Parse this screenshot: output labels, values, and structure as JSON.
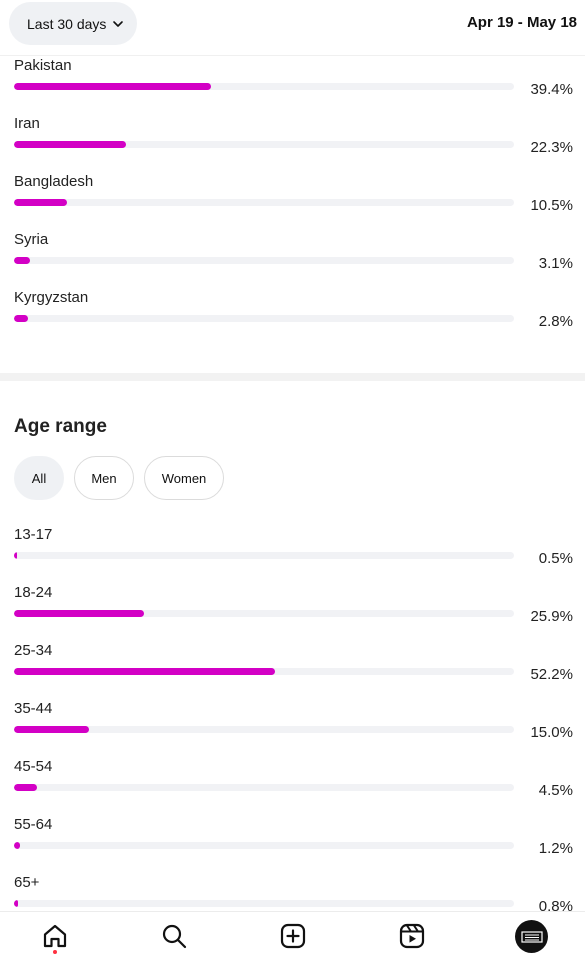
{
  "header": {
    "range_label": "Last 30 days",
    "date_range": "Apr 19 - May 18"
  },
  "countries": [
    {
      "label": "Pakistan",
      "percent": "39.4%",
      "value": 39.4
    },
    {
      "label": "Iran",
      "percent": "22.3%",
      "value": 22.3
    },
    {
      "label": "Bangladesh",
      "percent": "10.5%",
      "value": 10.5
    },
    {
      "label": "Syria",
      "percent": "3.1%",
      "value": 3.1
    },
    {
      "label": "Kyrgyzstan",
      "percent": "2.8%",
      "value": 2.8
    }
  ],
  "age": {
    "title": "Age range",
    "filters": [
      "All",
      "Men",
      "Women"
    ],
    "selected_filter": "All",
    "ranges": [
      {
        "label": "13-17",
        "percent": "0.5%",
        "value": 0.5
      },
      {
        "label": "18-24",
        "percent": "25.9%",
        "value": 25.9
      },
      {
        "label": "25-34",
        "percent": "52.2%",
        "value": 52.2
      },
      {
        "label": "35-44",
        "percent": "15.0%",
        "value": 15.0
      },
      {
        "label": "45-54",
        "percent": "4.5%",
        "value": 4.5
      },
      {
        "label": "55-64",
        "percent": "1.2%",
        "value": 1.2
      },
      {
        "label": "65+",
        "percent": "0.8%",
        "value": 0.8
      }
    ]
  },
  "bottom_nav": {
    "items": [
      "home-icon",
      "search-icon",
      "create-icon",
      "reels-icon",
      "profile-avatar"
    ],
    "active": "home-icon"
  },
  "colors": {
    "bar_fill": "#d300c5",
    "bar_track": "#f1f2f5",
    "notification_dot": "#ff3040"
  }
}
